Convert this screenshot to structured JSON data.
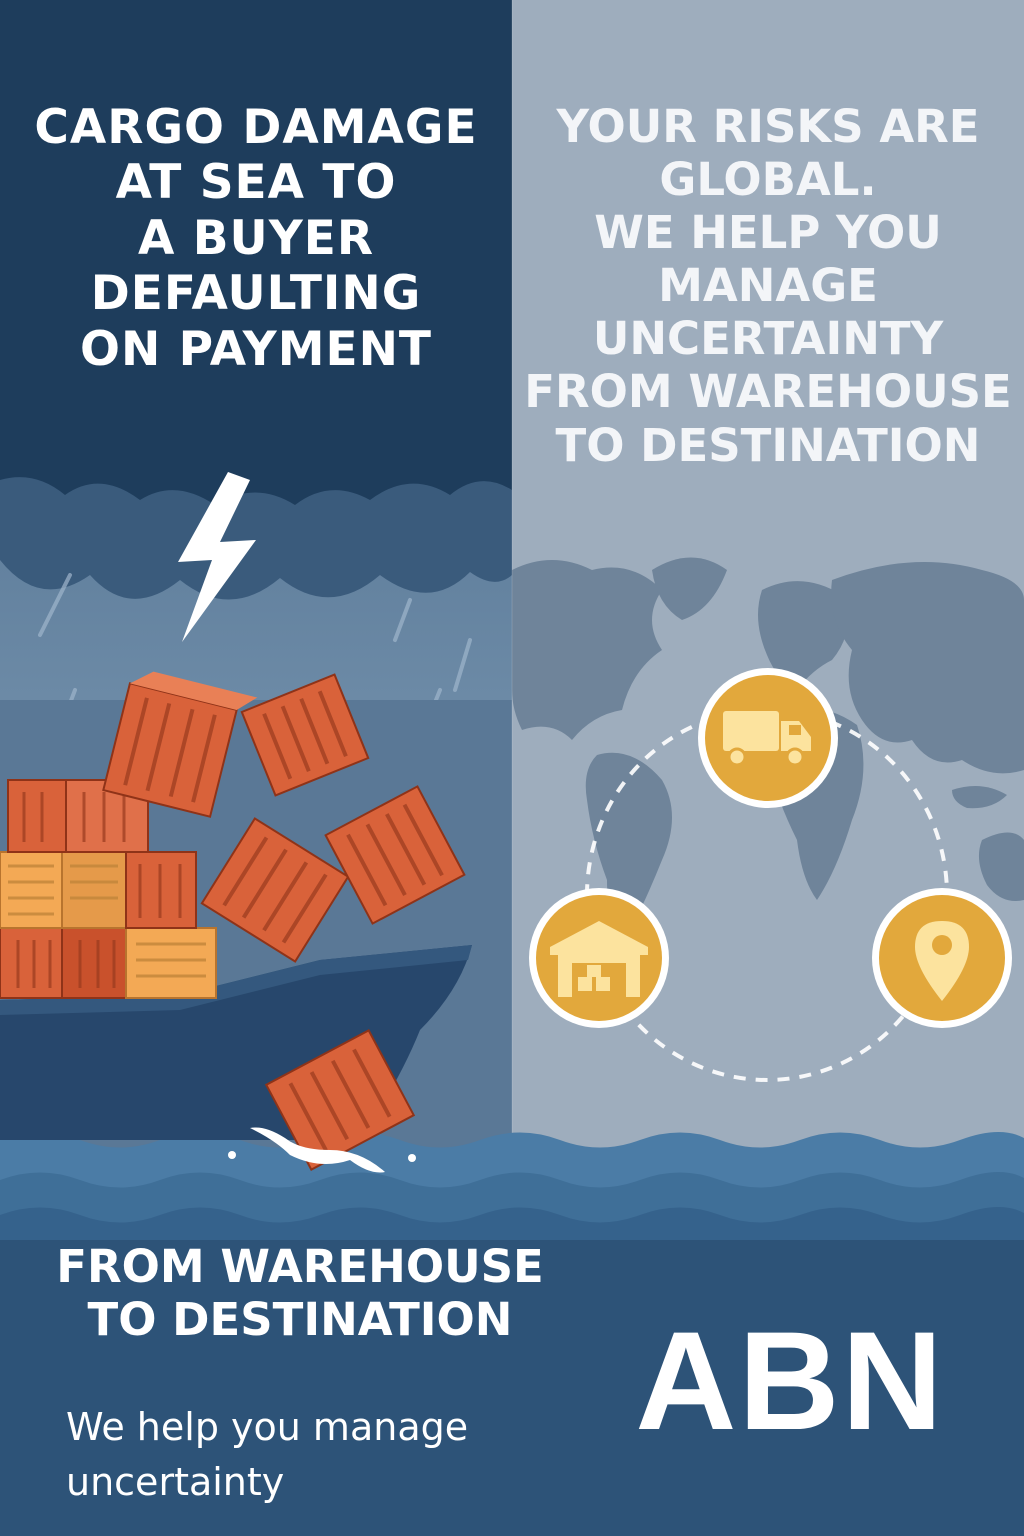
{
  "left": {
    "headline": "CARGO DAMAGE\nAT SEA TO\nA BUYER\nDEFAULTING\nON PAYMENT"
  },
  "right": {
    "headline": "YOUR RISKS ARE\nGLOBAL.\nWE HELP YOU\nMANAGE UNCERTAINTY\nFROM WAREHOUSE\nTO DESTINATION",
    "route_icons": [
      "truck-icon",
      "warehouse-icon",
      "location-pin-icon"
    ]
  },
  "bottom": {
    "sub_headline": "FROM WAREHOUSE\nTO DESTINATION",
    "tagline": "We help you manage\nuncertainty",
    "brand": "ABN"
  },
  "colors": {
    "storm_navy": "#1e3d5c",
    "container_orange": "#d9623a",
    "container_light": "#f3a955",
    "icon_gold": "#e2a83c",
    "sea_blue": "#3f6f98"
  }
}
